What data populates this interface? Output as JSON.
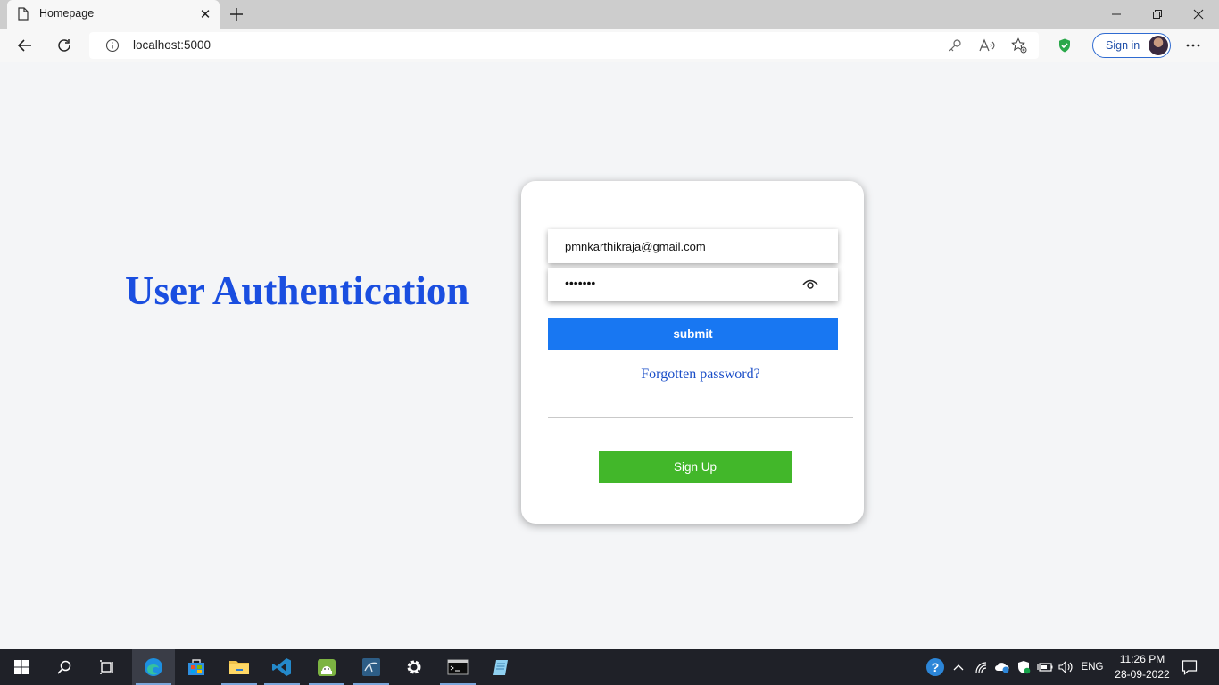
{
  "browser": {
    "tab_title": "Homepage",
    "url": "localhost:5000",
    "signin_label": "Sign in"
  },
  "page": {
    "heading": "User Authentication",
    "email_value": "pmnkarthikraja@gmail.com",
    "password_masked": "•••••••",
    "submit_label": "submit",
    "forgot_label": "Forgotten password?",
    "signup_label": "Sign Up"
  },
  "colors": {
    "heading": "#1a4ee0",
    "submit_bg": "#1877f2",
    "signup_bg": "#42b72a"
  },
  "taskbar": {
    "apps": [
      "start-icon",
      "search-icon",
      "task-view-icon",
      "edge-icon",
      "store-icon",
      "file-explorer-icon",
      "vscode-icon",
      "android-studio-icon",
      "mysql-workbench-icon",
      "settings-icon",
      "terminal-icon",
      "notepad-icon"
    ],
    "language": "ENG",
    "time": "11:26 PM",
    "date": "28-09-2022"
  }
}
